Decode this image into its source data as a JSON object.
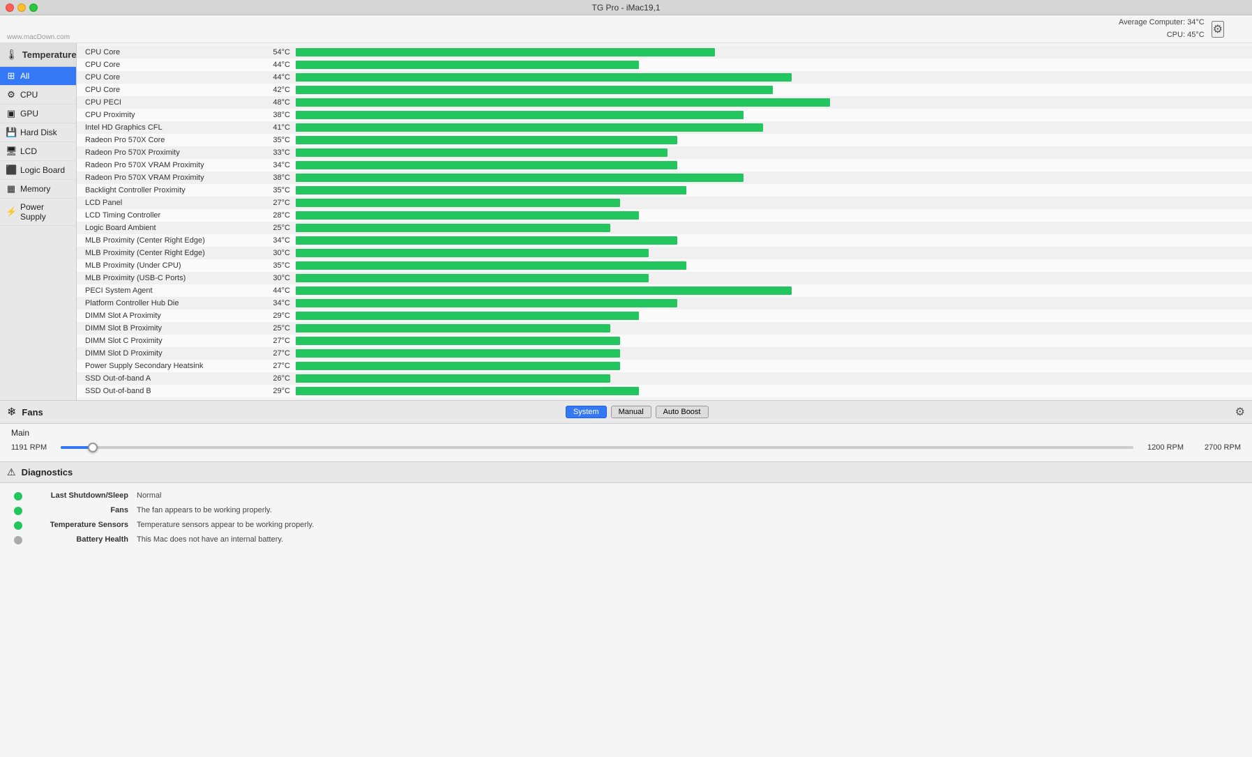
{
  "titlebar": {
    "title": "TG Pro - iMac19,1"
  },
  "header": {
    "avg_computer_label": "Average Computer:",
    "avg_computer_value": "34°C",
    "cpu_label": "CPU:",
    "cpu_value": "45°C"
  },
  "watermark": "www.macDown.com",
  "temperatures": {
    "section_label": "Temperatures",
    "sidebar": {
      "items": [
        {
          "id": "all",
          "label": "All",
          "icon": "⊞",
          "active": true
        },
        {
          "id": "cpu",
          "label": "CPU",
          "icon": "⚙",
          "active": false
        },
        {
          "id": "gpu",
          "label": "GPU",
          "icon": "▣",
          "active": false
        },
        {
          "id": "harddisk",
          "label": "Hard Disk",
          "icon": "💾",
          "active": false
        },
        {
          "id": "lcd",
          "label": "LCD",
          "icon": "🖥",
          "active": false
        },
        {
          "id": "logicboard",
          "label": "Logic Board",
          "icon": "⬛",
          "active": false
        },
        {
          "id": "memory",
          "label": "Memory",
          "icon": "▦",
          "active": false
        },
        {
          "id": "powersupply",
          "label": "Power Supply",
          "icon": "⚡",
          "active": false
        }
      ]
    },
    "rows": [
      {
        "name": "CPU Core",
        "value": "54°C",
        "bar_pct": 44
      },
      {
        "name": "CPU Core",
        "value": "44°C",
        "bar_pct": 36
      },
      {
        "name": "CPU Core",
        "value": "44°C",
        "bar_pct": 52
      },
      {
        "name": "CPU Core",
        "value": "42°C",
        "bar_pct": 50
      },
      {
        "name": "CPU PECI",
        "value": "48°C",
        "bar_pct": 56
      },
      {
        "name": "CPU Proximity",
        "value": "38°C",
        "bar_pct": 47
      },
      {
        "name": "Intel HD Graphics CFL",
        "value": "41°C",
        "bar_pct": 49
      },
      {
        "name": "Radeon Pro 570X Core",
        "value": "35°C",
        "bar_pct": 40
      },
      {
        "name": "Radeon Pro 570X Proximity",
        "value": "33°C",
        "bar_pct": 39
      },
      {
        "name": "Radeon Pro 570X VRAM Proximity",
        "value": "34°C",
        "bar_pct": 40
      },
      {
        "name": "Radeon Pro 570X VRAM Proximity",
        "value": "38°C",
        "bar_pct": 47
      },
      {
        "name": "Backlight Controller Proximity",
        "value": "35°C",
        "bar_pct": 41
      },
      {
        "name": "LCD Panel",
        "value": "27°C",
        "bar_pct": 34
      },
      {
        "name": "LCD Timing Controller",
        "value": "28°C",
        "bar_pct": 36
      },
      {
        "name": "Logic Board Ambient",
        "value": "25°C",
        "bar_pct": 33
      },
      {
        "name": "MLB Proximity (Center Right Edge)",
        "value": "34°C",
        "bar_pct": 40
      },
      {
        "name": "MLB Proximity (Center Right Edge)",
        "value": "30°C",
        "bar_pct": 37
      },
      {
        "name": "MLB Proximity (Under CPU)",
        "value": "35°C",
        "bar_pct": 41
      },
      {
        "name": "MLB Proximity (USB-C Ports)",
        "value": "30°C",
        "bar_pct": 37
      },
      {
        "name": "PECI System Agent",
        "value": "44°C",
        "bar_pct": 52
      },
      {
        "name": "Platform Controller Hub Die",
        "value": "34°C",
        "bar_pct": 40
      },
      {
        "name": "DIMM Slot A Proximity",
        "value": "29°C",
        "bar_pct": 36
      },
      {
        "name": "DIMM Slot B Proximity",
        "value": "25°C",
        "bar_pct": 33
      },
      {
        "name": "DIMM Slot C Proximity",
        "value": "27°C",
        "bar_pct": 34
      },
      {
        "name": "DIMM Slot D Proximity",
        "value": "27°C",
        "bar_pct": 34
      },
      {
        "name": "Power Supply Secondary Heatsink",
        "value": "27°C",
        "bar_pct": 34
      },
      {
        "name": "SSD Out-of-band A",
        "value": "26°C",
        "bar_pct": 33
      },
      {
        "name": "SSD Out-of-band B",
        "value": "29°C",
        "bar_pct": 36
      }
    ]
  },
  "fans": {
    "section_label": "Fans",
    "section_icon": "❄",
    "modes": [
      {
        "id": "system",
        "label": "System",
        "active": true
      },
      {
        "id": "manual",
        "label": "Manual",
        "active": false
      },
      {
        "id": "autoboost",
        "label": "Auto Boost",
        "active": false
      }
    ],
    "gear_icon": "⚙",
    "items": [
      {
        "name": "Main",
        "current_rpm": "1191 RPM",
        "min_rpm": "1200 RPM",
        "max_rpm": "2700 RPM",
        "pct": 3
      }
    ]
  },
  "diagnostics": {
    "section_label": "Diagnostics",
    "section_icon": "⚠",
    "rows": [
      {
        "label": "Last Shutdown/Sleep",
        "value": "Normal",
        "status": "green"
      },
      {
        "label": "Fans",
        "value": "The fan appears to be working properly.",
        "status": "green"
      },
      {
        "label": "Temperature Sensors",
        "value": "Temperature sensors appear to be working properly.",
        "status": "green"
      },
      {
        "label": "Battery Health",
        "value": "This Mac does not have an internal battery.",
        "status": "gray"
      }
    ]
  }
}
